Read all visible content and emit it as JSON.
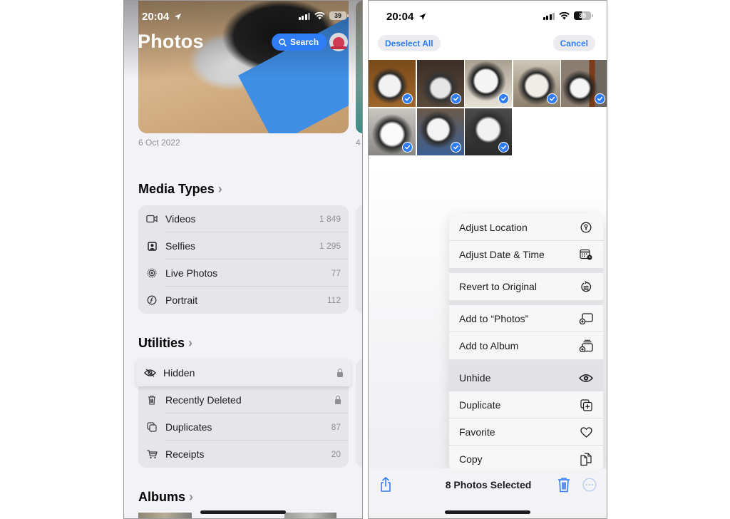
{
  "left": {
    "status": {
      "time": "20:04",
      "battery": "39"
    },
    "header": {
      "title": "Photos",
      "search_label": "Search"
    },
    "featured": {
      "date": "6 Oct 2022",
      "next_date_peek": "4"
    },
    "media_types": {
      "title": "Media Types",
      "items": [
        {
          "icon": "video-icon",
          "label": "Videos",
          "count": "1 849"
        },
        {
          "icon": "selfie-icon",
          "label": "Selfies",
          "count": "1 295"
        },
        {
          "icon": "live-photo-icon",
          "label": "Live Photos",
          "count": "77"
        },
        {
          "icon": "portrait-icon",
          "label": "Portrait",
          "count": "112"
        }
      ]
    },
    "utilities": {
      "title": "Utilities",
      "items": [
        {
          "icon": "eye-slash-icon",
          "label": "Hidden",
          "count": "",
          "locked": true
        },
        {
          "icon": "trash-icon",
          "label": "Recently Deleted",
          "count": "",
          "locked": true
        },
        {
          "icon": "duplicates-icon",
          "label": "Duplicates",
          "count": "87"
        },
        {
          "icon": "cart-icon",
          "label": "Receipts",
          "count": "20"
        }
      ]
    },
    "albums": {
      "title": "Albums"
    }
  },
  "right": {
    "status": {
      "time": "20:04",
      "battery": "39"
    },
    "header": {
      "deselect_label": "Deselect All",
      "cancel_label": "Cancel"
    },
    "grid": {
      "selected_count": 8
    },
    "menu": {
      "groups": [
        [
          {
            "label": "Adjust Location",
            "icon": "location-pin-icon"
          },
          {
            "label": "Adjust Date & Time",
            "icon": "calendar-clock-icon"
          }
        ],
        [
          {
            "label": "Revert to Original",
            "icon": "revert-icon"
          }
        ],
        [
          {
            "label": "Add to “Photos”",
            "icon": "add-to-photos-icon"
          },
          {
            "label": "Add to Album",
            "icon": "add-to-album-icon"
          }
        ],
        [
          {
            "label": "Unhide",
            "icon": "eye-icon",
            "active": true
          },
          {
            "label": "Duplicate",
            "icon": "duplicate-icon"
          },
          {
            "label": "Favorite",
            "icon": "heart-icon"
          },
          {
            "label": "Copy",
            "icon": "copy-icon"
          }
        ]
      ]
    },
    "toolbar": {
      "title": "8 Photos Selected"
    }
  },
  "colors": {
    "accent": "#2f7df6",
    "background": "#f2f2f7",
    "group": "#e5e5ea"
  }
}
